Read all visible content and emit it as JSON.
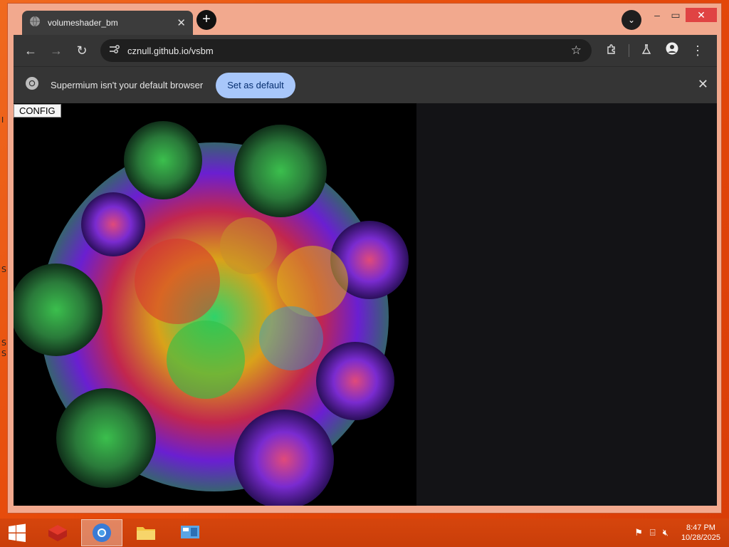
{
  "desktop": {
    "fragments": [
      "I",
      "S",
      "S",
      "S"
    ]
  },
  "browser": {
    "tab": {
      "title": "volumeshader_bm",
      "close_icon": "close-icon"
    },
    "new_tab_label": "+",
    "address": {
      "url": "cznull.github.io/vsbm"
    },
    "infobar": {
      "message": "Supermium isn't your default browser",
      "button_label": "Set as default"
    }
  },
  "page": {
    "config_label": "CONFIG"
  },
  "taskbar": {
    "clock_time": "8:47 PM",
    "clock_date": "10/28/2025"
  },
  "colors": {
    "accent": "#a8c7fa",
    "window_frame": "#f2a98e",
    "desktop": "#e8510f",
    "close_button": "#e04343"
  }
}
